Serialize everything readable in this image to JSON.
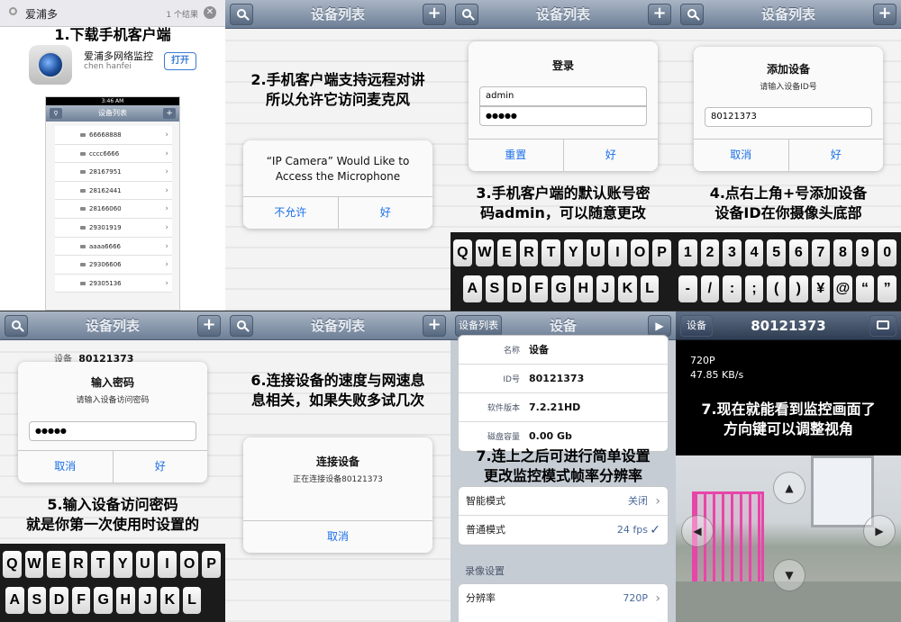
{
  "p1": {
    "search_text": "爱浦多",
    "result_count": "1 个结果",
    "caption": "1.下载手机客户端",
    "app_name": "爱浦多网络监控",
    "app_author": "chen hanfei",
    "open_button": "打开",
    "mini_status_time": "3:46 AM",
    "mini_title": "设备列表",
    "device_ids": [
      "66668888",
      "cccc6666",
      "28167951",
      "28162441",
      "28166060",
      "29301919",
      "aaaa6666",
      "29306606",
      "29305136"
    ]
  },
  "p2": {
    "nav_title": "设备列表",
    "caption_line1": "2.手机客户端支持远程对讲",
    "caption_line2": "所以允许它访问麦克风",
    "dialog_line1": "“IP Camera” Would Like to",
    "dialog_line2": "Access the Microphone",
    "deny": "不允许",
    "ok": "好"
  },
  "p3": {
    "nav_title": "设备列表",
    "dialog_title": "登录",
    "username": "admin",
    "password": "●●●●●",
    "reset": "重置",
    "ok": "好",
    "caption_line1": "3.手机客户端的默认账号密",
    "caption_line2": "码admin，可以随意更改",
    "keys_row1": [
      "Q",
      "W",
      "E",
      "R",
      "T",
      "Y",
      "U",
      "I",
      "O",
      "P"
    ],
    "keys_row2": [
      "A",
      "S",
      "D",
      "F",
      "G",
      "H",
      "J",
      "K",
      "L"
    ]
  },
  "p4": {
    "nav_title": "设备列表",
    "dialog_title": "添加设备",
    "dialog_sub": "请输入设备ID号",
    "device_id": "80121373",
    "cancel": "取消",
    "ok": "好",
    "caption_line1": "4.点右上角+号添加设备",
    "caption_line2": "设备ID在你摄像头底部",
    "keys_row1": [
      "1",
      "2",
      "3",
      "4",
      "5",
      "6",
      "7",
      "8",
      "9",
      "0"
    ],
    "keys_row2": [
      "-",
      "/",
      ":",
      ";",
      "(",
      ")",
      "¥",
      "@",
      "“",
      "”"
    ]
  },
  "p5": {
    "nav_title": "设备列表",
    "bg_label": "设备",
    "bg_id": "80121373",
    "dialog_title": "输入密码",
    "dialog_sub": "请输入设备访问密码",
    "password": "●●●●●",
    "cancel": "取消",
    "ok": "好",
    "caption_line1": "5.输入设备访问密码",
    "caption_line2": "就是你第一次使用时设置的",
    "keys_row1": [
      "Q",
      "W",
      "E",
      "R",
      "T",
      "Y",
      "U",
      "I",
      "O",
      "P"
    ],
    "keys_row2": [
      "A",
      "S",
      "D",
      "F",
      "G",
      "H",
      "J",
      "K",
      "L"
    ]
  },
  "p6": {
    "nav_title": "设备列表",
    "caption_line1": "6.连接设备的速度与网速息",
    "caption_line2": "息相关，如果失败多试几次",
    "dialog_title": "连接设备",
    "dialog_sub": "正在连接设备80121373",
    "cancel": "取消"
  },
  "p7": {
    "back_button": "设备列表",
    "nav_title": "设备",
    "rows_top": [
      {
        "label": "名称",
        "value": "设备"
      },
      {
        "label": "ID号",
        "value": "80121373"
      },
      {
        "label": "软件版本",
        "value": "7.2.21HD"
      },
      {
        "label": "磁盘容量",
        "value": "0.00 Gb"
      }
    ],
    "caption_line1": "7.连上之后可进行简单设置",
    "caption_line2": "更改监控模式帧率分辨率",
    "mode_rows": [
      {
        "label": "智能模式",
        "value": "关闭"
      },
      {
        "label": "普通模式",
        "value": "24 fps"
      }
    ],
    "section_title": "录像设置",
    "resolution_label": "分辨率",
    "resolution_value": "720P"
  },
  "p8": {
    "back_button": "设备",
    "nav_title": "80121373",
    "resolution": "720P",
    "speed": "47.85 KB/s",
    "caption_line1": "7.现在就能看到监控画面了",
    "caption_line2": "方向键可以调整视角"
  }
}
